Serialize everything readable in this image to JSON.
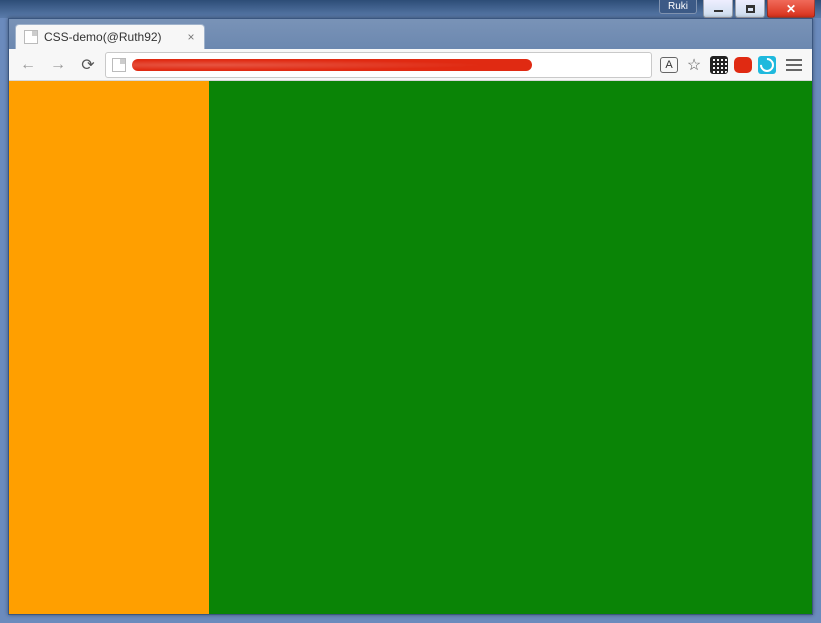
{
  "window": {
    "badge": "Ruki"
  },
  "browser": {
    "tab": {
      "title": "CSS-demo(@Ruth92)"
    },
    "toolbar": {
      "translate_label": "A",
      "star_glyph": "☆"
    }
  },
  "page": {
    "left_color": "#ff9f00",
    "right_color": "#0a8406"
  }
}
